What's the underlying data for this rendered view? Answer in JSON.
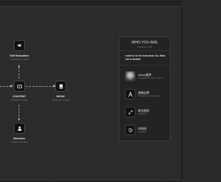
{
  "canvas": {
    "nodes": [
      {
        "id": "self-education",
        "title": "Self Education",
        "subtitle": "16 boards, 17 cards",
        "icon": "bird-icon"
      },
      {
        "id": "content",
        "title": "CONTENT",
        "subtitle": "29 boards, 6 cards",
        "icon": "play-icon"
      },
      {
        "id": "book",
        "title": "BOOK",
        "subtitle": "36 boards, 4 cards",
        "icon": "book-icon"
      },
      {
        "id": "monetize",
        "title": "Monetize",
        "subtitle": "3 boards, 58 cards",
        "icon": "money-icon"
      }
    ]
  },
  "panel": {
    "title": "WHO YOU ARE",
    "subtitle": "4 boards, 1 card",
    "description": "I want to be the best what I do. What I do is flexible.",
    "items": [
      {
        "title": "Zimon要梦",
        "subtitle": "7 boards, 21 cards, 6 items",
        "icon": "avatar"
      },
      {
        "title": "故事品牌",
        "subtitle": "13 cards, 4 documents",
        "icon": "compass-icon"
      },
      {
        "title": "职业规划",
        "subtitle": "13 cards",
        "icon": "route-icon"
      },
      {
        "title": "时间线",
        "subtitle": "10 cards",
        "icon": "clock-history-icon"
      }
    ]
  }
}
